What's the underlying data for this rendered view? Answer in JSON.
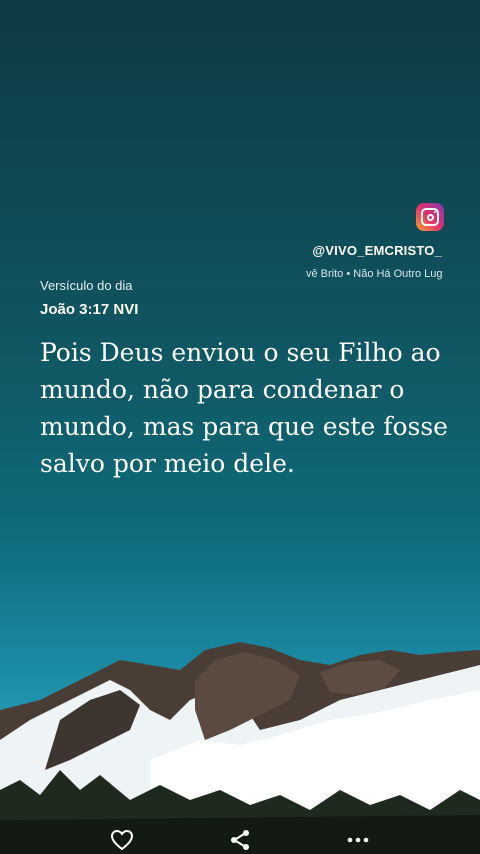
{
  "overlay": {
    "instagram_handle": "@VIVO_EMCRISTO_",
    "music_ticker": "vê Brito • Não Há Outro Lug"
  },
  "verse": {
    "label": "Versículo do dia",
    "reference": "João 3:17 NVI",
    "text": "Pois Deus enviou o seu Filho ao mundo, não para condenar o mundo, mas para que este fosse salvo por meio dele."
  },
  "actions": {
    "icons": [
      "heart-icon",
      "share-icon",
      "more-icon"
    ]
  },
  "colors": {
    "sky_top": "#0e3a44",
    "sky_bottom": "#2ba0bb",
    "text": "#ffffff"
  }
}
